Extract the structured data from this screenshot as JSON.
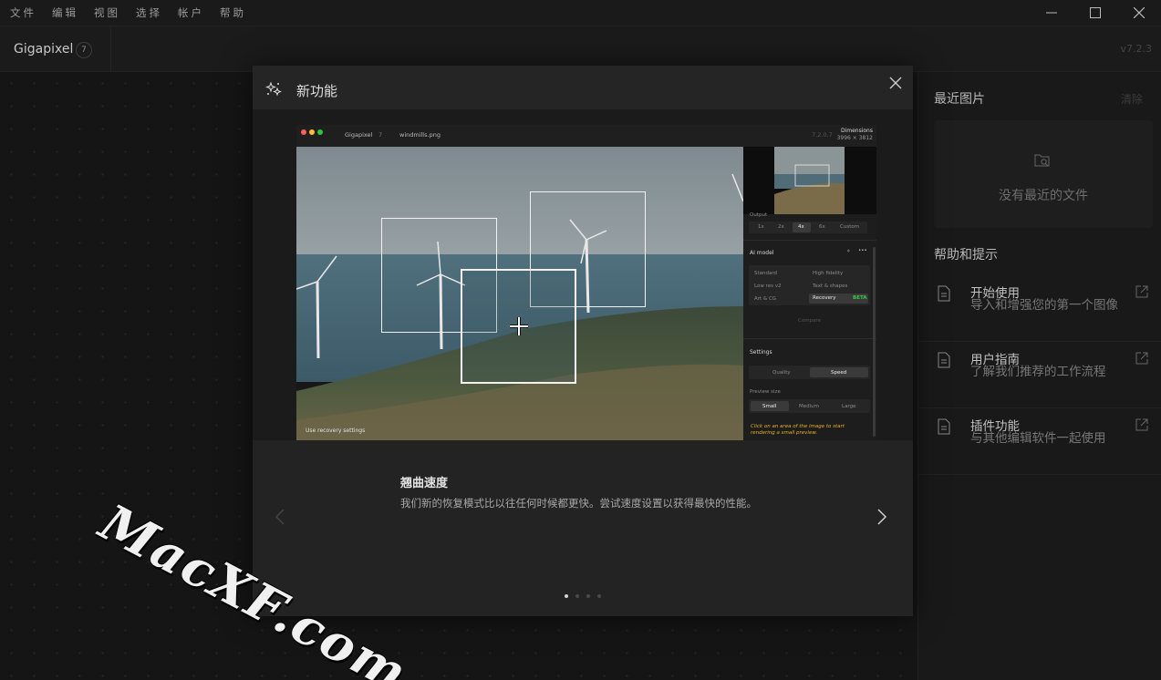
{
  "menu": [
    "文件",
    "编辑",
    "视图",
    "选择",
    "帐户",
    "帮助"
  ],
  "app": {
    "name": "Gigapixel",
    "badge": "7",
    "version": "v7.2.3"
  },
  "right_panel": {
    "recent_title": "最近图片",
    "clear_label": "清除",
    "recent_empty": "没有最近的文件",
    "help_title": "帮助和提示",
    "help_items": [
      {
        "title": "开始使用",
        "desc": "导入和增强您的第一个图像"
      },
      {
        "title": "用户指南",
        "desc": "了解我们推荐的工作流程"
      },
      {
        "title": "插件功能",
        "desc": "与其他编辑软件一起使用"
      }
    ]
  },
  "modal": {
    "title": "新功能",
    "slide_title": "翘曲速度",
    "slide_desc": "我们新的恢复模式比以往任何时候都更快。尝试速度设置以获得最快的性能。",
    "pager": {
      "count": 4,
      "active": 0
    },
    "preview": {
      "app_name": "Gigapixel",
      "app_badge": "7",
      "file_name": "windmills.png",
      "version": "7.2.0.7",
      "dimensions_label": "Dimensions",
      "dimensions_value": "3996 × 3812",
      "output_label": "Output",
      "scale_options": [
        "1x",
        "2x",
        "4x",
        "6x",
        "Custom"
      ],
      "scale_selected": "4x",
      "ai_model_label": "AI model",
      "models": [
        "Standard",
        "High fidelity",
        "Low res v2",
        "Text & shapes",
        "Art & CG",
        "Recovery"
      ],
      "recovery_badge": "BETA",
      "compare_label": "Compare",
      "settings_label": "Settings",
      "settings_options": [
        "Quality",
        "Speed"
      ],
      "settings_selected": "Speed",
      "preview_size_label": "Preview size",
      "preview_sizes": [
        "Small",
        "Medium",
        "Large"
      ],
      "preview_size_selected": "Small",
      "note": "Click on an area of the image to start rendering a small preview.",
      "bottom_label": "Use recovery settings"
    }
  },
  "watermark": "MacXF.com",
  "colors": {
    "accent_green": "#3ec64a",
    "note_yellow": "#e6b322",
    "background": "#161616"
  }
}
